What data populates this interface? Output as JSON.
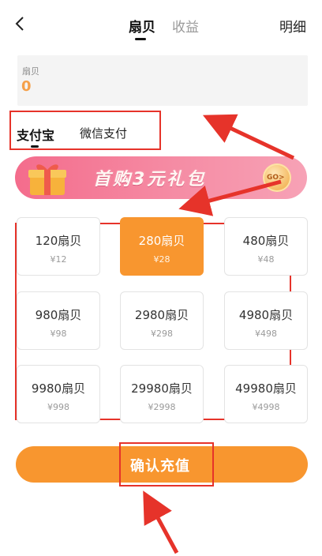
{
  "header": {
    "tabs": [
      {
        "label": "扇贝",
        "active": true
      },
      {
        "label": "收益",
        "active": false
      }
    ],
    "detail_label": "明细",
    "back_icon": "chevron-left-icon"
  },
  "balance": {
    "label": "扇贝",
    "value": "0"
  },
  "payment": {
    "methods": [
      {
        "label": "支付宝",
        "active": true
      },
      {
        "label": "微信支付",
        "active": false
      }
    ]
  },
  "banner": {
    "text": "首购3元礼包",
    "icon": "gift-icon",
    "badge_text": "GO>"
  },
  "packages": [
    {
      "name": "120扇贝",
      "price": "¥12",
      "selected": false
    },
    {
      "name": "280扇贝",
      "price": "¥28",
      "selected": true
    },
    {
      "name": "480扇贝",
      "price": "¥48",
      "selected": false
    },
    {
      "name": "980扇贝",
      "price": "¥98",
      "selected": false
    },
    {
      "name": "2980扇贝",
      "price": "¥298",
      "selected": false
    },
    {
      "name": "4980扇贝",
      "price": "¥498",
      "selected": false
    },
    {
      "name": "9980扇贝",
      "price": "¥998",
      "selected": false
    },
    {
      "name": "29980扇贝",
      "price": "¥2998",
      "selected": false
    },
    {
      "name": "49980扇贝",
      "price": "¥4998",
      "selected": false
    }
  ],
  "confirm": {
    "label": "确认充值"
  },
  "colors": {
    "accent": "#f8962f",
    "annotation": "#e6332a",
    "balance_value": "#f5a04a",
    "banner": "#f46c8c"
  }
}
